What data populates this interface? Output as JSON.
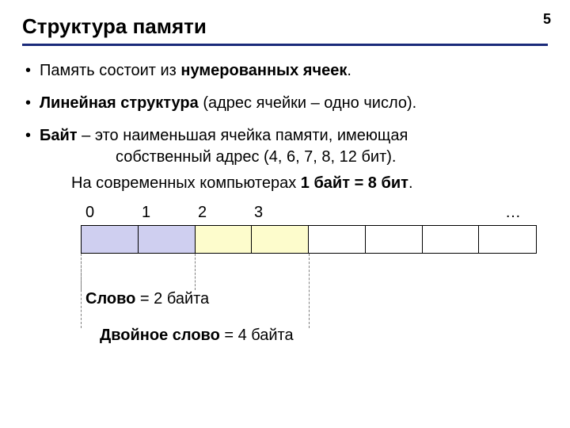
{
  "page_number": "5",
  "title": "Структура памяти",
  "bullets": {
    "b1_pre": "Память состоит из ",
    "b1_bold": "нумерованных ячеек",
    "b1_post": ".",
    "b2_bold": "Линейная структура",
    "b2_post": " (адрес ячейки – одно число).",
    "b3_bold": "Байт",
    "b3_post1": " – это наименьшая ячейка памяти, имеющая",
    "b3_line2": "собственный адрес (4, 6, 7, 8, 12 бит).",
    "b3_sub_pre": "На современных компьютерах ",
    "b3_sub_bold": "1 байт = 8 бит",
    "b3_sub_post": "."
  },
  "cells": {
    "labels": [
      "0",
      "1",
      "2",
      "3"
    ],
    "dots": "…"
  },
  "word": {
    "bold": "Слово",
    "rest": " = 2 байта"
  },
  "dword": {
    "bold": "Двойное слово",
    "rest": " = 4 байта"
  }
}
